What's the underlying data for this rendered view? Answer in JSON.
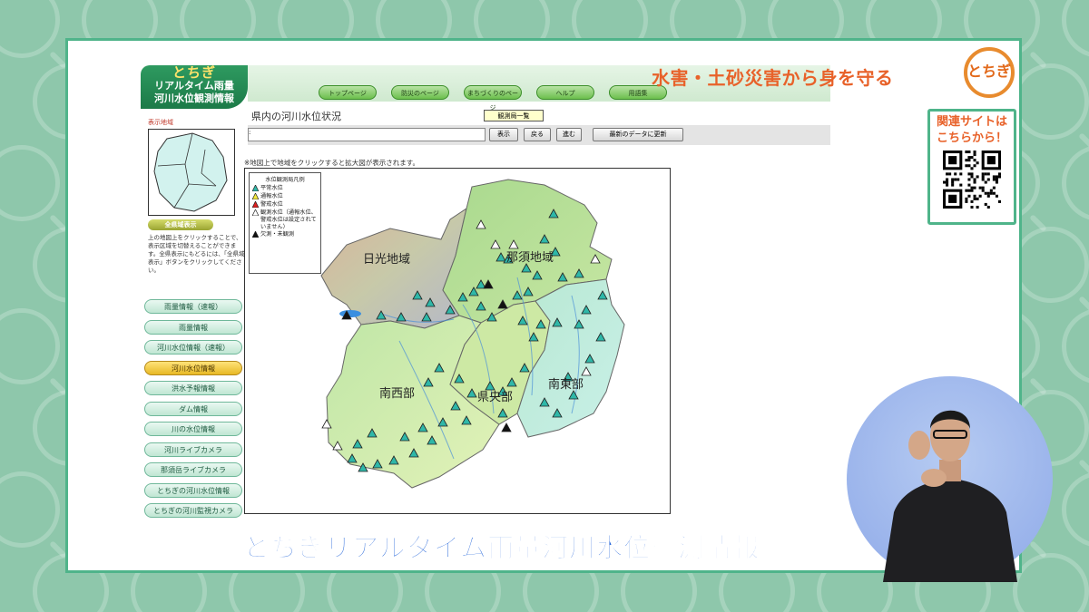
{
  "overlay": {
    "slogan": "水害・土砂災害から身を守る",
    "mascot_text": "とちぎ",
    "related_sites_line1": "関連サイトは",
    "related_sites_line2": "こちらから！",
    "caption": "とちぎリアルタイム雨量河川水位観測情報",
    "colors": {
      "frame": "#4fb48a",
      "background": "#8ec7ab",
      "slogan": "#e8622a",
      "caption": "#1b5fd8",
      "signer_bg": "#9db6ec"
    }
  },
  "site": {
    "logo_line1": "とちぎ",
    "logo_line2": "リアルタイム雨量",
    "logo_line3": "河川水位観測情報",
    "nav": [
      "トップページ",
      "防災のページ",
      "まちづくりのページ",
      "ヘルプ",
      "用語集"
    ],
    "side": {
      "area_label": "表示地域",
      "pref_button": "全県域表示",
      "note": "上の地図上をクリックすることで、表示区域を切替えることができます。全県表示にもどるには、「全県域表示」ボタンをクリックしてください。",
      "menu": [
        "雨量情報（速報）",
        "雨量情報",
        "河川水位情報（速報）",
        "河川水位情報",
        "洪水予報情報",
        "ダム情報",
        "川の水位情報",
        "河川ライブカメラ",
        "那須岳ライブカメラ",
        "とちぎの河川水位情報",
        "とちぎの河川監視カメラ"
      ],
      "active_index": 3
    },
    "main": {
      "title": "県内の河川水位状況",
      "obs_list_button": "観測局一覧",
      "input_value": ":",
      "buttons": [
        "表示",
        "戻る",
        "進む",
        "最新のデータに更新"
      ],
      "map_note": "※地図上で地域をクリックすると拡大図が表示されます。",
      "legend": {
        "title": "水位観測局凡例",
        "items": [
          {
            "label": "平常水位",
            "color": "#2fb7a8"
          },
          {
            "label": "通報水位",
            "color": "#f2e83a"
          },
          {
            "label": "警戒水位",
            "color": "#e02020"
          },
          {
            "label": "観測水位（通報水位、警戒水位は設定されていません）",
            "color": "#ffffff"
          },
          {
            "label": "欠測・未観測",
            "color": "#111111"
          }
        ]
      },
      "regions": [
        "日光地域",
        "那須地域",
        "南西部",
        "県央部",
        "南東部"
      ]
    }
  }
}
